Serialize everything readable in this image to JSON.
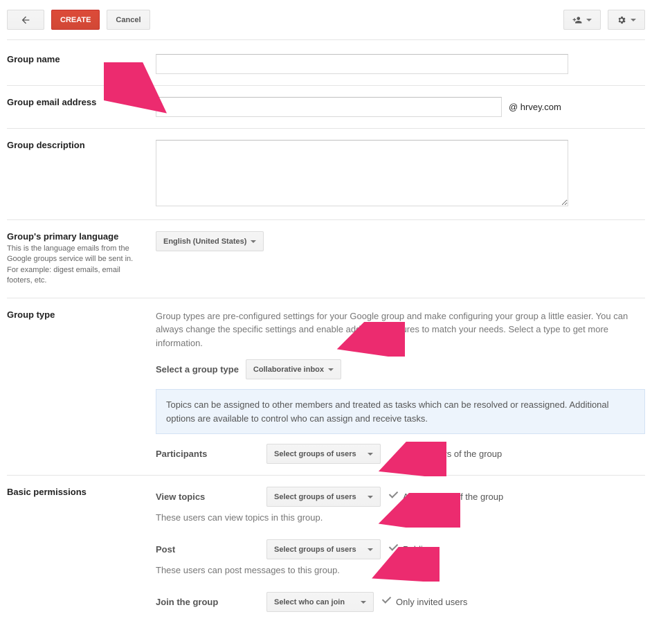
{
  "toolbar": {
    "create_label": "CREATE",
    "cancel_label": "Cancel"
  },
  "fields": {
    "group_name": {
      "label": "Group name"
    },
    "group_email": {
      "label": "Group email address",
      "suffix": "@ hrvey.com"
    },
    "group_description": {
      "label": "Group description"
    },
    "primary_language": {
      "label": "Group's primary language",
      "help": "This is the language emails from the Google groups service will be sent in. For example: digest emails, email footers, etc.",
      "value": "English (United States)"
    },
    "group_type": {
      "label": "Group type",
      "description": "Group types are pre-configured settings for your Google group and make configuring your group a little easier. You can always change the specific settings and enable additional features to match your needs. Select a type to get more information.",
      "select_label": "Select a group type",
      "value": "Collaborative inbox",
      "info": "Topics can be assigned to other members and treated as tasks which can be resolved or reassigned. Additional options are available to control who can assign and receive tasks.",
      "participants_label": "Participants",
      "participants_select": "Select groups of users",
      "participants_value": "All members of the group"
    },
    "permissions": {
      "label": "Basic permissions",
      "view_topics": {
        "label": "View topics",
        "select": "Select groups of users",
        "value": "All members of the group",
        "help": "These users can view topics in this group."
      },
      "post": {
        "label": "Post",
        "select": "Select groups of users",
        "value": "Public",
        "help": "These users can post messages to this group."
      },
      "join": {
        "label": "Join the group",
        "select": "Select who can join",
        "value": "Only invited users"
      }
    }
  }
}
